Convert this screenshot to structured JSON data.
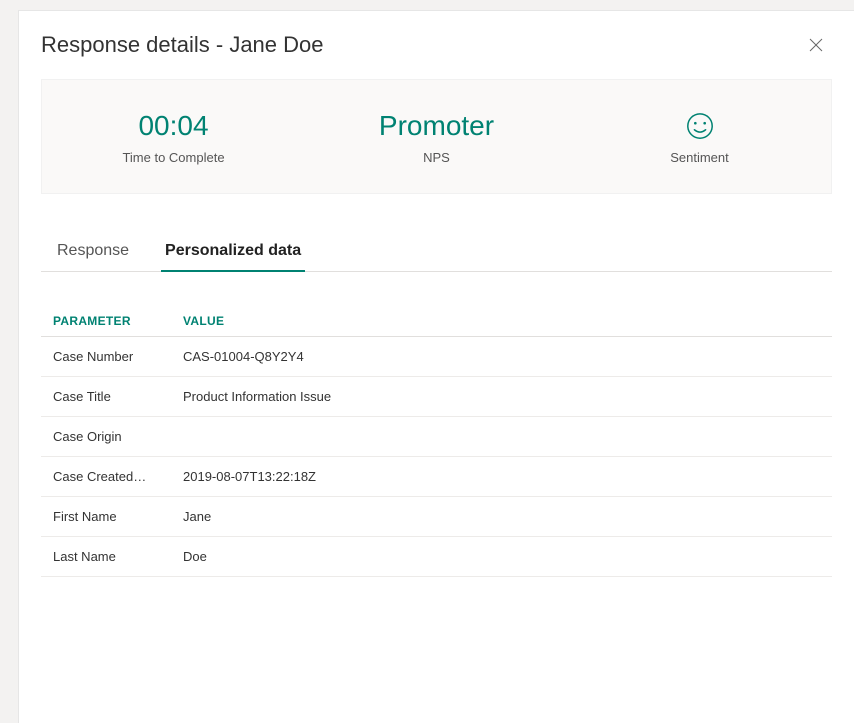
{
  "modal": {
    "title": "Response details - Jane Doe"
  },
  "summary": {
    "time": {
      "value": "00:04",
      "label": "Time to Complete"
    },
    "nps": {
      "value": "Promoter",
      "label": "NPS"
    },
    "sentiment": {
      "label": "Sentiment"
    }
  },
  "tabs": {
    "response": "Response",
    "personalized": "Personalized data"
  },
  "table": {
    "headers": {
      "parameter": "PARAMETER",
      "value": "VALUE"
    },
    "rows": [
      {
        "param": "Case Number",
        "value": "CAS-01004-Q8Y2Y4"
      },
      {
        "param": "Case Title",
        "value": "Product Information Issue"
      },
      {
        "param": "Case Origin",
        "value": ""
      },
      {
        "param": "Case Created…",
        "value": "2019-08-07T13:22:18Z"
      },
      {
        "param": "First Name",
        "value": "Jane"
      },
      {
        "param": "Last Name",
        "value": "Doe"
      }
    ]
  }
}
